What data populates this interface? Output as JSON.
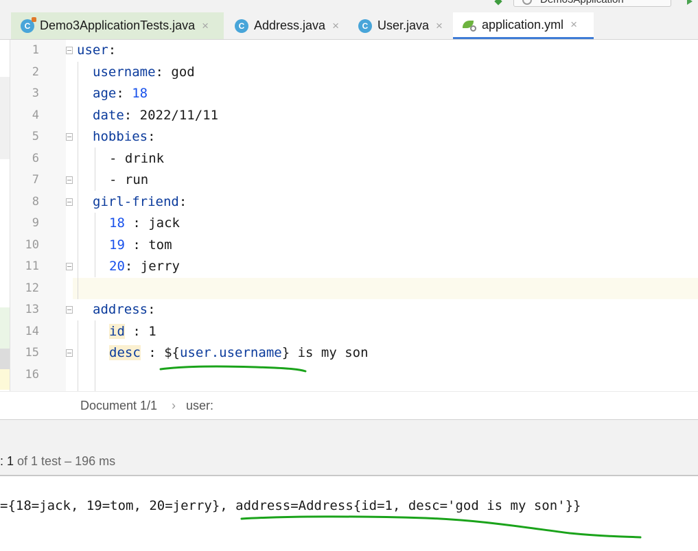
{
  "run_config": {
    "label": "Demo3Application"
  },
  "tabs": [
    {
      "label": "Demo3ApplicationTests.java",
      "icon": "java-class-icon",
      "close": "×"
    },
    {
      "label": "Address.java",
      "icon": "java-class-icon",
      "close": "×"
    },
    {
      "label": "User.java",
      "icon": "java-class-icon",
      "close": "×"
    },
    {
      "label": "application.yml",
      "icon": "spring-yaml-icon",
      "close": "×",
      "active": true
    }
  ],
  "editor": {
    "lines": [
      {
        "n": "1",
        "key": "user",
        "sep": ":"
      },
      {
        "n": "2",
        "key": "username",
        "sep": ": ",
        "val": "god"
      },
      {
        "n": "3",
        "key": "age",
        "sep": ": ",
        "num": "18"
      },
      {
        "n": "4",
        "key": "date",
        "sep": ": ",
        "val": "2022/11/11"
      },
      {
        "n": "5",
        "key": "hobbies",
        "sep": ":"
      },
      {
        "n": "6",
        "text": "- drink"
      },
      {
        "n": "7",
        "text": "- run"
      },
      {
        "n": "8",
        "key": "girl-friend",
        "sep": ":"
      },
      {
        "n": "9",
        "num": "18",
        "sep": " : ",
        "val": "jack"
      },
      {
        "n": "10",
        "num": "19",
        "sep": " : ",
        "val": "tom"
      },
      {
        "n": "11",
        "num": "20",
        "sep": ": ",
        "val": "jerry"
      },
      {
        "n": "12"
      },
      {
        "n": "13",
        "key": "address",
        "sep": ":"
      },
      {
        "n": "14",
        "key": "id",
        "sep": " : ",
        "val": "1"
      },
      {
        "n": "15",
        "key": "desc",
        "sep": " : ",
        "pre": "${",
        "ref": "user.username",
        "post": "} is my son"
      },
      {
        "n": "16"
      }
    ]
  },
  "breadcrumb": {
    "doc": "Document 1/1",
    "sep": "›",
    "path": "user:"
  },
  "run": {
    "status_prefix": ": ",
    "status_count": "1",
    "status_rest": " of 1 test – 196 ms"
  },
  "console": {
    "line": "={18=jack, 19=tom, 20=jerry}, address=Address{id=1, desc='god is my son'}}"
  },
  "colors": {
    "annotation": "#1aa31a",
    "active_tab_underline": "#3f7cd6",
    "current_line": "#fcfaed"
  }
}
